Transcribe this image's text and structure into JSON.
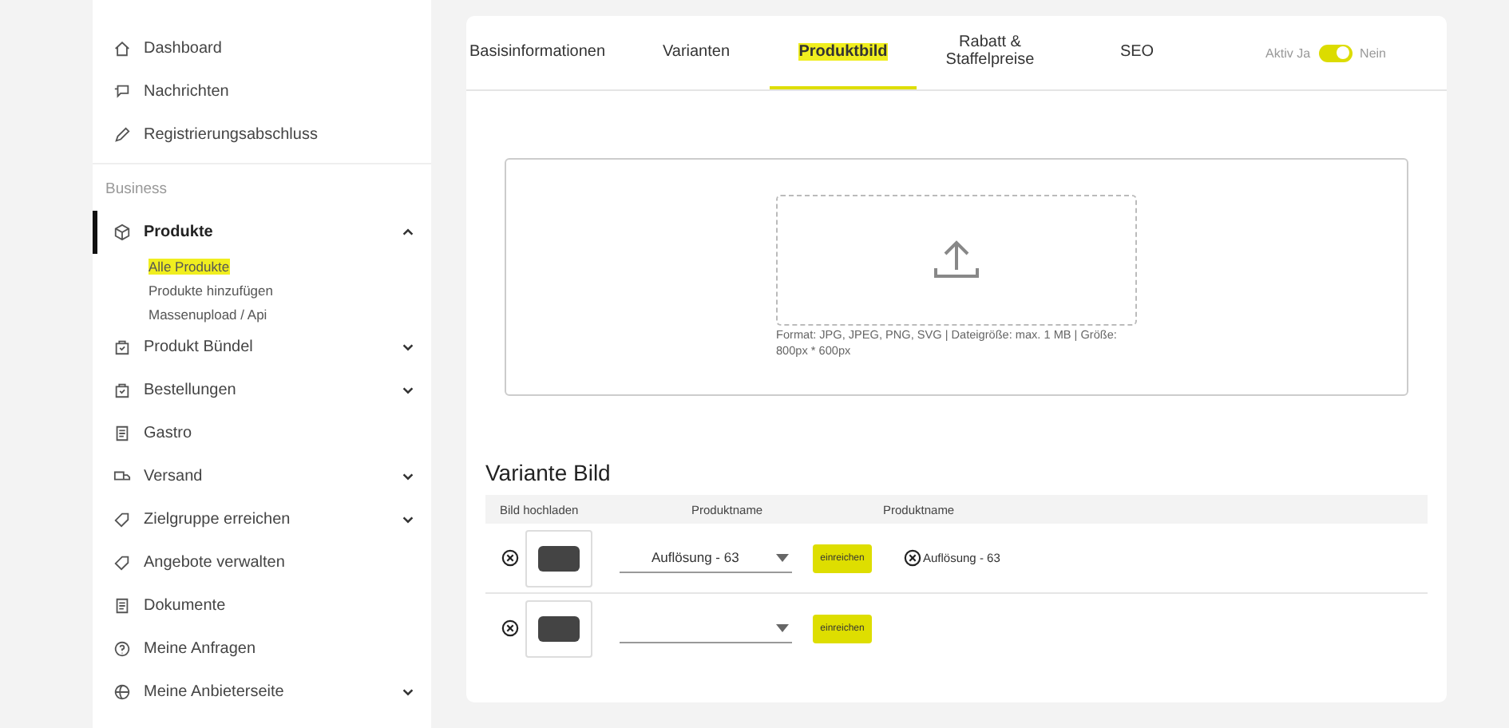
{
  "sidebar": {
    "items": [
      {
        "label": "Dashboard",
        "selected": false
      },
      {
        "label": "Nachrichten",
        "selected": false
      },
      {
        "label": "Registrierungsabschluss",
        "selected": false
      },
      {
        "kind": "section",
        "label": "Business"
      },
      {
        "label": "Produkte",
        "selected": true,
        "expanded": true,
        "children": [
          {
            "label": "Alle Produkte",
            "selected": true
          },
          {
            "label": "Produkte hinzufügen",
            "selected": false
          },
          {
            "label": "Massenupload / Api",
            "selected": false
          }
        ]
      },
      {
        "label": "Produkt Bündel",
        "selected": false,
        "expanded": false
      },
      {
        "label": "Bestellungen",
        "selected": false,
        "expanded": false
      },
      {
        "label": "Gastro",
        "selected": false
      },
      {
        "label": "Versand",
        "selected": false,
        "expanded": false
      },
      {
        "label": "Zielgruppe erreichen",
        "selected": false,
        "expanded": false
      },
      {
        "label": "Angebote verwalten",
        "selected": false
      },
      {
        "label": "Dokumente",
        "selected": false
      },
      {
        "label": "Meine Anfragen",
        "selected": false
      },
      {
        "label": "Meine Anbieterseite",
        "selected": false,
        "expanded": false
      }
    ]
  },
  "tabs": [
    {
      "label": "Basisinformationen",
      "selected": false
    },
    {
      "label": "Varianten",
      "selected": false
    },
    {
      "label": "Produktbild",
      "selected": true
    },
    {
      "label": "Rabatt & Staffelpreise",
      "selected": false
    },
    {
      "label": "SEO",
      "selected": false
    }
  ],
  "active_toggle": {
    "label": "Aktiv Ja",
    "off_label": "Nein",
    "on": true
  },
  "upload": {
    "hint": "Format: JPG, JPEG, PNG, SVG | Dateigröße: max. 1 MB | Größe: 800px * 600px"
  },
  "variant_section": {
    "title": "Variante Bild",
    "columns": [
      "Bild hochladen",
      "Produktname",
      "Produktname"
    ],
    "rows": [
      {
        "product": "Auflösung - 63",
        "button": "einreichen",
        "result": "Auflösung - 63"
      },
      {
        "button": "einreichen"
      }
    ]
  }
}
